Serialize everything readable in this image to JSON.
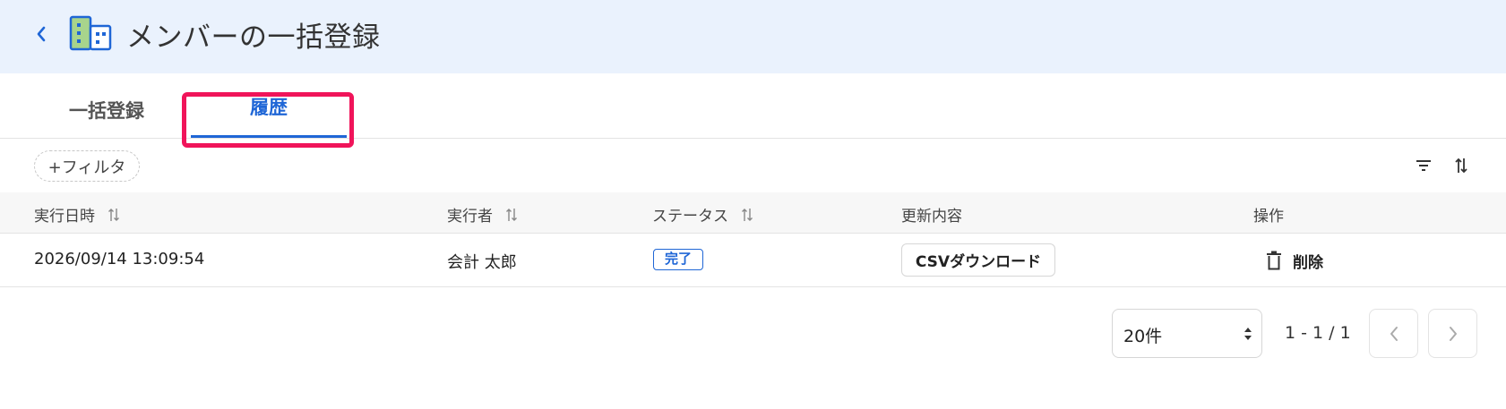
{
  "header": {
    "title": "メンバーの一括登録",
    "back_icon": "chevron-left-icon",
    "app_icon": "building-icon",
    "accent_color": "#1f66d6"
  },
  "tabs": [
    {
      "label": "一括登録",
      "active": false
    },
    {
      "label": "履歴",
      "active": true
    }
  ],
  "toolbar": {
    "filter_label": "+フィルタ",
    "filter_icon": "filter-icon",
    "sort_icon": "sort-icon"
  },
  "table": {
    "columns": [
      "実行日時",
      "実行者",
      "ステータス",
      "更新内容",
      "操作"
    ],
    "rows": [
      {
        "executed_at": "2026/09/14 13:09:54",
        "executor": "会計 太郎",
        "status": "完了",
        "update_action": "CSVダウンロード",
        "operation": "削除"
      }
    ]
  },
  "pagination": {
    "per_page": "20件",
    "range": "1 - 1 / 1"
  },
  "highlight_color": "#f0145a"
}
